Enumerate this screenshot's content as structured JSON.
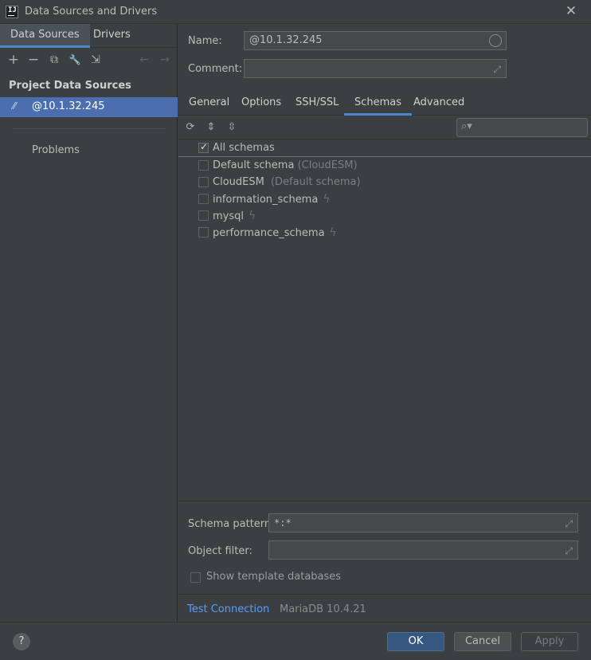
{
  "window": {
    "title": "Data Sources and Drivers"
  },
  "left": {
    "tabs": [
      {
        "label": "Data Sources",
        "active": true
      },
      {
        "label": "Drivers",
        "active": false
      }
    ],
    "toolbar": {
      "add": "+",
      "remove": "−",
      "duplicate": "⧉",
      "properties": "🔧",
      "import": "⇲",
      "back": "←",
      "forward": "→"
    },
    "section_title": "Project Data Sources",
    "selected_item": "@10.1.32.245",
    "problems": "Problems"
  },
  "right": {
    "name_label": "Name:",
    "name_value": "@10.1.32.245",
    "comment_label": "Comment:",
    "comment_value": "",
    "tabs": [
      {
        "label": "General",
        "active": false
      },
      {
        "label": "Options",
        "active": false
      },
      {
        "label": "SSH/SSL",
        "active": false
      },
      {
        "label": "Schemas",
        "active": true
      },
      {
        "label": "Advanced",
        "active": false
      }
    ],
    "schemas": [
      {
        "label": "All schemas",
        "suffix": "",
        "checked": true,
        "bolt": false
      },
      {
        "label": "Default schema",
        "suffix": "(CloudESM)",
        "checked": false,
        "bolt": false
      },
      {
        "label": "CloudESM",
        "suffix": "(Default schema)",
        "checked": false,
        "bolt": false
      },
      {
        "label": "information_schema",
        "suffix": "",
        "checked": false,
        "bolt": true
      },
      {
        "label": "mysql",
        "suffix": "",
        "checked": false,
        "bolt": true
      },
      {
        "label": "performance_schema",
        "suffix": "",
        "checked": false,
        "bolt": true
      }
    ],
    "schema_pattern_label": "Schema pattern:",
    "schema_pattern_value": "*:*",
    "object_filter_label": "Object filter:",
    "object_filter_value": "",
    "show_template_label": "Show template databases",
    "test_connection": "Test Connection",
    "db_version": "MariaDB 10.4.21"
  },
  "footer": {
    "help": "?",
    "ok": "OK",
    "cancel": "Cancel",
    "apply": "Apply"
  },
  "colors": {
    "accent": "#4a88c7",
    "selection": "#4b6eaf",
    "link": "#589df6",
    "primary_button": "#365880"
  }
}
